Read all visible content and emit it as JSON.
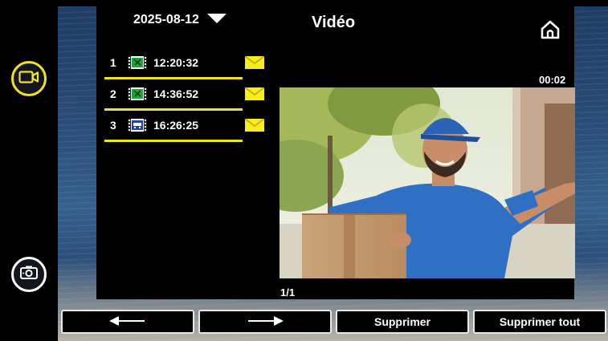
{
  "header": {
    "date": "2025-08-12",
    "title": "Vidéo"
  },
  "records": [
    {
      "index": "1",
      "time": "12:20:32",
      "type": "video"
    },
    {
      "index": "2",
      "time": "14:36:52",
      "type": "video"
    },
    {
      "index": "3",
      "time": "16:26:25",
      "type": "intercom"
    }
  ],
  "player": {
    "duration": "00:02",
    "page_indicator": "1/1"
  },
  "buttons": {
    "delete_label": "Supprimer",
    "delete_all_label": "Supprimer tout"
  },
  "icons": {
    "video_mode": "video-camera-icon",
    "photo_mode": "camera-icon",
    "home": "home-icon",
    "unread": "envelope-icon",
    "prev": "arrow-left-icon",
    "next": "arrow-right-icon"
  },
  "colors": {
    "accent": "#f2e21a",
    "thumb_video": "#1aa63a",
    "thumb_intercom": "#1f3fbf"
  }
}
